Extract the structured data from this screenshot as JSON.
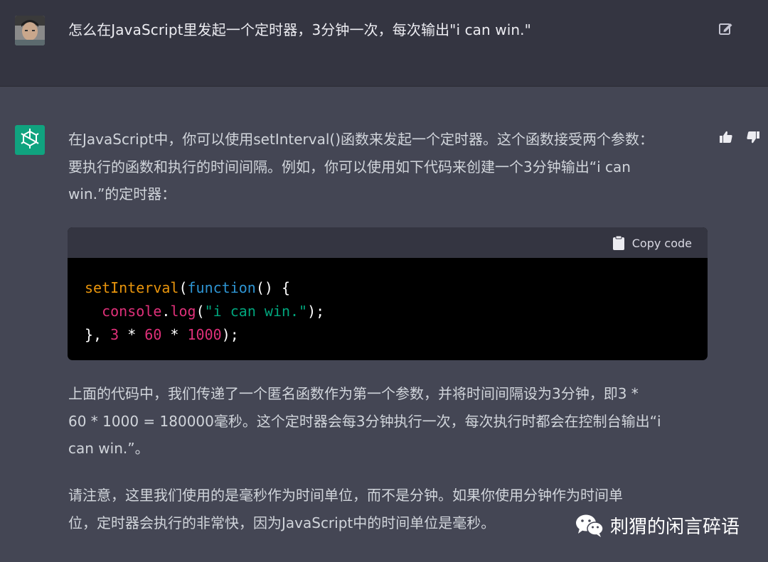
{
  "user_message": {
    "text": "怎么在JavaScript里发起一个定时器，3分钟一次，每次输出\"i can win.\""
  },
  "assistant_message": {
    "intro_lines": [
      "在JavaScript中，你可以使用setInterval()函数来发起一个定时器。这个函数接受两个参数：",
      "要执行的函数和执行的时间间隔。例如，你可以使用如下代码来创建一个3分钟输出“i can",
      "win.”的定时器："
    ],
    "code_block": {
      "copy_label": "Copy code",
      "line1": {
        "fn": "setInterval",
        "p1": "(",
        "kw": "function",
        "p2": "() {"
      },
      "line2": {
        "indent": "  ",
        "obj": "console",
        "dot": ".",
        "method": "log",
        "p1": "(",
        "str": "\"i can win.\"",
        "p2": ");"
      },
      "line3": {
        "p1": "}, ",
        "n1": "3",
        "op1": " * ",
        "n2": "60",
        "op2": " * ",
        "n3": "1000",
        "p2": ");"
      }
    },
    "explanation_lines": [
      "上面的代码中，我们传递了一个匿名函数作为第一个参数，并将时间间隔设为3分钟，即3 *",
      "60 * 1000 = 180000毫秒。这个定时器会每3分钟执行一次，每次执行时都会在控制台输出“i",
      "can win.”。"
    ],
    "note_lines": [
      "请注意，这里我们使用的是毫秒作为时间单位，而不是分钟。如果你使用分钟作为时间单",
      "位，定时器会执行的非常快，因为JavaScript中的时间单位是毫秒。"
    ]
  },
  "watermark": {
    "text": "刺猬的闲言碎语",
    "icon": "wechat-icon"
  },
  "icons": {
    "edit": "edit-icon",
    "thumb_up": "thumbs-up-icon",
    "thumb_down": "thumbs-down-icon",
    "clipboard": "clipboard-icon",
    "logo": "openai-logo-icon"
  },
  "colors": {
    "user_bg": "#343541",
    "assistant_bg": "#444654",
    "logo_bg": "#10a37f",
    "code_bg": "#000000"
  }
}
